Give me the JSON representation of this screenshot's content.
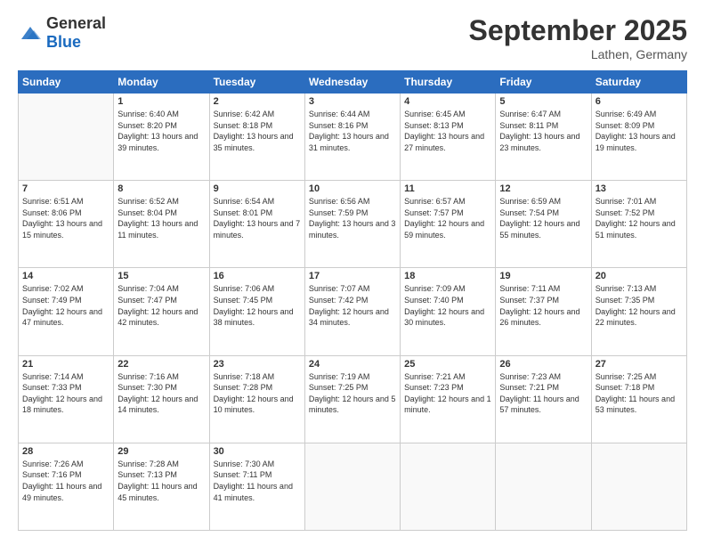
{
  "header": {
    "logo_general": "General",
    "logo_blue": "Blue",
    "month_title": "September 2025",
    "location": "Lathen, Germany"
  },
  "weekdays": [
    "Sunday",
    "Monday",
    "Tuesday",
    "Wednesday",
    "Thursday",
    "Friday",
    "Saturday"
  ],
  "weeks": [
    [
      {
        "day": "",
        "sunrise": "",
        "sunset": "",
        "daylight": ""
      },
      {
        "day": "1",
        "sunrise": "Sunrise: 6:40 AM",
        "sunset": "Sunset: 8:20 PM",
        "daylight": "Daylight: 13 hours and 39 minutes."
      },
      {
        "day": "2",
        "sunrise": "Sunrise: 6:42 AM",
        "sunset": "Sunset: 8:18 PM",
        "daylight": "Daylight: 13 hours and 35 minutes."
      },
      {
        "day": "3",
        "sunrise": "Sunrise: 6:44 AM",
        "sunset": "Sunset: 8:16 PM",
        "daylight": "Daylight: 13 hours and 31 minutes."
      },
      {
        "day": "4",
        "sunrise": "Sunrise: 6:45 AM",
        "sunset": "Sunset: 8:13 PM",
        "daylight": "Daylight: 13 hours and 27 minutes."
      },
      {
        "day": "5",
        "sunrise": "Sunrise: 6:47 AM",
        "sunset": "Sunset: 8:11 PM",
        "daylight": "Daylight: 13 hours and 23 minutes."
      },
      {
        "day": "6",
        "sunrise": "Sunrise: 6:49 AM",
        "sunset": "Sunset: 8:09 PM",
        "daylight": "Daylight: 13 hours and 19 minutes."
      }
    ],
    [
      {
        "day": "7",
        "sunrise": "Sunrise: 6:51 AM",
        "sunset": "Sunset: 8:06 PM",
        "daylight": "Daylight: 13 hours and 15 minutes."
      },
      {
        "day": "8",
        "sunrise": "Sunrise: 6:52 AM",
        "sunset": "Sunset: 8:04 PM",
        "daylight": "Daylight: 13 hours and 11 minutes."
      },
      {
        "day": "9",
        "sunrise": "Sunrise: 6:54 AM",
        "sunset": "Sunset: 8:01 PM",
        "daylight": "Daylight: 13 hours and 7 minutes."
      },
      {
        "day": "10",
        "sunrise": "Sunrise: 6:56 AM",
        "sunset": "Sunset: 7:59 PM",
        "daylight": "Daylight: 13 hours and 3 minutes."
      },
      {
        "day": "11",
        "sunrise": "Sunrise: 6:57 AM",
        "sunset": "Sunset: 7:57 PM",
        "daylight": "Daylight: 12 hours and 59 minutes."
      },
      {
        "day": "12",
        "sunrise": "Sunrise: 6:59 AM",
        "sunset": "Sunset: 7:54 PM",
        "daylight": "Daylight: 12 hours and 55 minutes."
      },
      {
        "day": "13",
        "sunrise": "Sunrise: 7:01 AM",
        "sunset": "Sunset: 7:52 PM",
        "daylight": "Daylight: 12 hours and 51 minutes."
      }
    ],
    [
      {
        "day": "14",
        "sunrise": "Sunrise: 7:02 AM",
        "sunset": "Sunset: 7:49 PM",
        "daylight": "Daylight: 12 hours and 47 minutes."
      },
      {
        "day": "15",
        "sunrise": "Sunrise: 7:04 AM",
        "sunset": "Sunset: 7:47 PM",
        "daylight": "Daylight: 12 hours and 42 minutes."
      },
      {
        "day": "16",
        "sunrise": "Sunrise: 7:06 AM",
        "sunset": "Sunset: 7:45 PM",
        "daylight": "Daylight: 12 hours and 38 minutes."
      },
      {
        "day": "17",
        "sunrise": "Sunrise: 7:07 AM",
        "sunset": "Sunset: 7:42 PM",
        "daylight": "Daylight: 12 hours and 34 minutes."
      },
      {
        "day": "18",
        "sunrise": "Sunrise: 7:09 AM",
        "sunset": "Sunset: 7:40 PM",
        "daylight": "Daylight: 12 hours and 30 minutes."
      },
      {
        "day": "19",
        "sunrise": "Sunrise: 7:11 AM",
        "sunset": "Sunset: 7:37 PM",
        "daylight": "Daylight: 12 hours and 26 minutes."
      },
      {
        "day": "20",
        "sunrise": "Sunrise: 7:13 AM",
        "sunset": "Sunset: 7:35 PM",
        "daylight": "Daylight: 12 hours and 22 minutes."
      }
    ],
    [
      {
        "day": "21",
        "sunrise": "Sunrise: 7:14 AM",
        "sunset": "Sunset: 7:33 PM",
        "daylight": "Daylight: 12 hours and 18 minutes."
      },
      {
        "day": "22",
        "sunrise": "Sunrise: 7:16 AM",
        "sunset": "Sunset: 7:30 PM",
        "daylight": "Daylight: 12 hours and 14 minutes."
      },
      {
        "day": "23",
        "sunrise": "Sunrise: 7:18 AM",
        "sunset": "Sunset: 7:28 PM",
        "daylight": "Daylight: 12 hours and 10 minutes."
      },
      {
        "day": "24",
        "sunrise": "Sunrise: 7:19 AM",
        "sunset": "Sunset: 7:25 PM",
        "daylight": "Daylight: 12 hours and 5 minutes."
      },
      {
        "day": "25",
        "sunrise": "Sunrise: 7:21 AM",
        "sunset": "Sunset: 7:23 PM",
        "daylight": "Daylight: 12 hours and 1 minute."
      },
      {
        "day": "26",
        "sunrise": "Sunrise: 7:23 AM",
        "sunset": "Sunset: 7:21 PM",
        "daylight": "Daylight: 11 hours and 57 minutes."
      },
      {
        "day": "27",
        "sunrise": "Sunrise: 7:25 AM",
        "sunset": "Sunset: 7:18 PM",
        "daylight": "Daylight: 11 hours and 53 minutes."
      }
    ],
    [
      {
        "day": "28",
        "sunrise": "Sunrise: 7:26 AM",
        "sunset": "Sunset: 7:16 PM",
        "daylight": "Daylight: 11 hours and 49 minutes."
      },
      {
        "day": "29",
        "sunrise": "Sunrise: 7:28 AM",
        "sunset": "Sunset: 7:13 PM",
        "daylight": "Daylight: 11 hours and 45 minutes."
      },
      {
        "day": "30",
        "sunrise": "Sunrise: 7:30 AM",
        "sunset": "Sunset: 7:11 PM",
        "daylight": "Daylight: 11 hours and 41 minutes."
      },
      {
        "day": "",
        "sunrise": "",
        "sunset": "",
        "daylight": ""
      },
      {
        "day": "",
        "sunrise": "",
        "sunset": "",
        "daylight": ""
      },
      {
        "day": "",
        "sunrise": "",
        "sunset": "",
        "daylight": ""
      },
      {
        "day": "",
        "sunrise": "",
        "sunset": "",
        "daylight": ""
      }
    ]
  ]
}
